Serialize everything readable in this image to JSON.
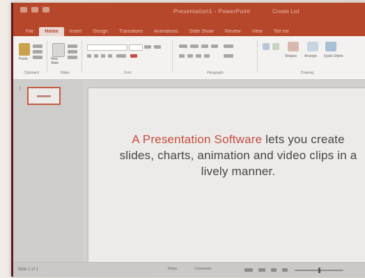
{
  "app": {
    "accent_color": "#b7472a",
    "title_text": "Presentation1 - PowerPoint",
    "account_text": "Create List"
  },
  "tabs": [
    "File",
    "Home",
    "Insert",
    "Design",
    "Transitions",
    "Animations",
    "Slide Show",
    "Review",
    "View",
    "Tell me"
  ],
  "ribbon": {
    "groups": [
      {
        "label": "Clipboard",
        "items": [
          "Paste"
        ]
      },
      {
        "label": "Slides",
        "items": [
          "New Slide"
        ]
      },
      {
        "label": "Font",
        "items": []
      },
      {
        "label": "Paragraph",
        "items": []
      },
      {
        "label": "Drawing",
        "items": [
          "Shapes",
          "Arrange",
          "Quick Styles"
        ]
      }
    ]
  },
  "thumbnails": {
    "number": "1"
  },
  "slide": {
    "highlight": "A Presentation Software",
    "body": " lets you create slides, charts, animation and video clips in a lively manner.",
    "highlight_color": "#c64d3d"
  },
  "statusbar": {
    "slide_info": "Slide 1 of 1",
    "notes": "Notes",
    "comments": "Comments"
  }
}
